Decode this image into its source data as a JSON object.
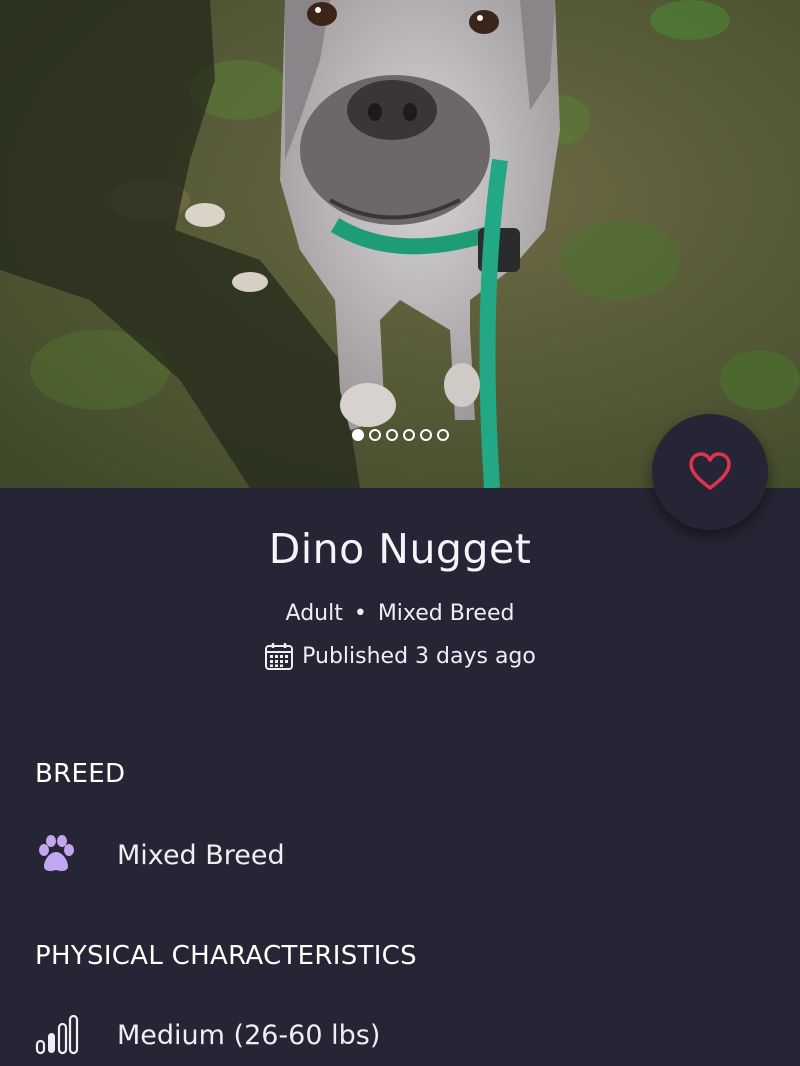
{
  "photo": {
    "icon": "dog-photo",
    "dots_total": 6,
    "dots_active_index": 0
  },
  "favorite": {
    "icon": "heart-icon",
    "color": "#e0334d"
  },
  "pet": {
    "name": "Dino Nugget",
    "age": "Adult",
    "separator": "•",
    "breed_summary": "Mixed Breed",
    "published": "Published 3 days ago"
  },
  "sections": {
    "breed": {
      "title": "BREED",
      "value": "Mixed Breed",
      "icon": "paw-icon",
      "icon_color": "#c3a6f0"
    },
    "physical": {
      "title": "PHYSICAL CHARACTERISTICS",
      "value": "Medium (26-60 lbs)",
      "icon": "size-bars-icon"
    }
  },
  "colors": {
    "background": "#262535",
    "text": "#ffffff"
  }
}
